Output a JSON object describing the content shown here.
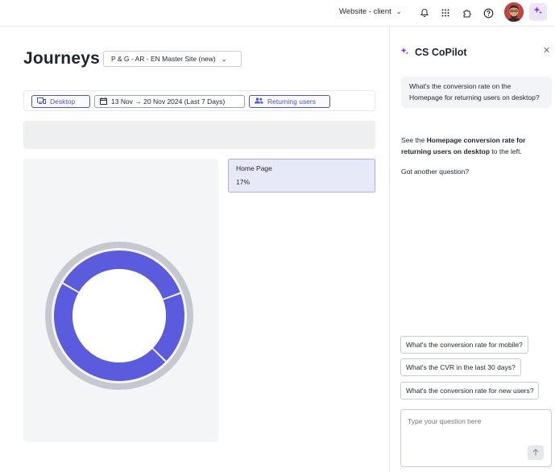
{
  "topbar": {
    "workspace_label": "Website - client",
    "icons": [
      "chevron-down-icon",
      "bell-icon",
      "grid-icon",
      "puzzle-icon",
      "help-icon",
      "avatar",
      "sparkle-icon"
    ]
  },
  "page": {
    "title": "Journeys",
    "site_select_value": "P & G - AR - EN Master Site (new)"
  },
  "filters": {
    "device": "Desktop",
    "date_range": "13 Nov → 20 Nov 2024 (Last 7 Days)",
    "segment": "Returning users"
  },
  "journey_card": {
    "title": "Home Page",
    "value": "17%"
  },
  "chart_data": {
    "type": "pie",
    "categories": [
      "",
      "",
      ""
    ],
    "values": [
      36,
      18,
      46
    ],
    "colors": {
      "segments": "#5b5bde",
      "outer_ring": "#c5c8cf"
    }
  },
  "copilot": {
    "title": "CS CoPilot",
    "user_message": "What's the conversion rate on the Homepage for returning users on desktop?",
    "bot_prefix": "See the ",
    "bot_bold_1": "Homepage conversion rate for returning users on desktop",
    "bot_suffix": " to the left.",
    "bot_followup": "Got another question?",
    "suggestions": [
      "What's the conversion rate for mobile?",
      "What's the CVR in the last 30 days?",
      "What's the conversion rate for new users?"
    ],
    "input_placeholder": "Type your question here"
  },
  "colors": {
    "accent": "#4a53d4",
    "chart": "#5b5bde",
    "card_bg": "#e8e9f7"
  }
}
